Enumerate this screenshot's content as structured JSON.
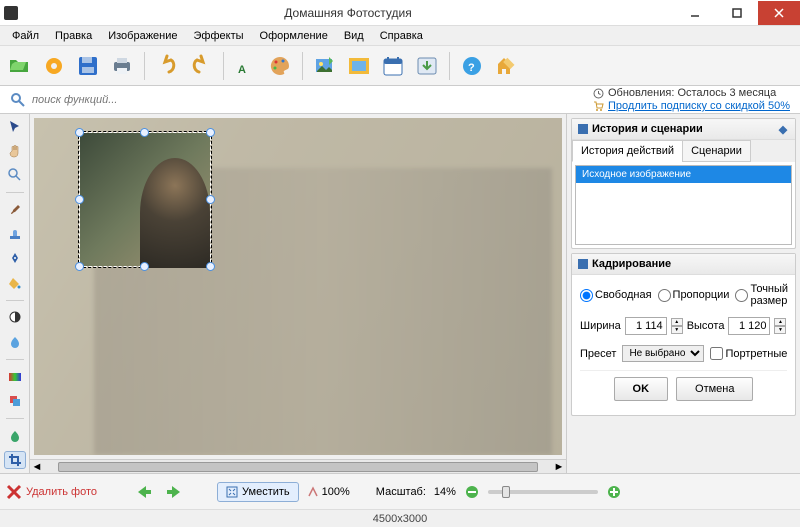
{
  "window": {
    "title": "Домашняя Фотостудия"
  },
  "menu": [
    "Файл",
    "Правка",
    "Изображение",
    "Эффекты",
    "Оформление",
    "Вид",
    "Справка"
  ],
  "search": {
    "placeholder": "поиск функций..."
  },
  "subscription": {
    "update_text": "Обновления: Осталось  3 месяца",
    "renew_link": "Продлить подписку со скидкой 50%"
  },
  "right_history": {
    "header": "История и сценарии",
    "tab_history": "История действий",
    "tab_scripts": "Сценарии",
    "items": [
      "Исходное изображение"
    ]
  },
  "crop_panel": {
    "header": "Кадрирование",
    "mode_free": "Свободная",
    "mode_prop": "Пропорции",
    "mode_exact": "Точный размер",
    "width_label": "Ширина",
    "width_value": "1 114",
    "height_label": "Высота",
    "height_value": "1 120",
    "preset_label": "Пресет",
    "preset_value": "Не выбрано",
    "portrait_check": "Портретные",
    "ok": "OK",
    "cancel": "Отмена"
  },
  "footer": {
    "delete": "Удалить фото",
    "fit": "Уместить",
    "zoom_100": "100%",
    "zoom_label": "Масштаб:",
    "zoom_value": "14%"
  },
  "status": {
    "dims": "4500x3000"
  }
}
